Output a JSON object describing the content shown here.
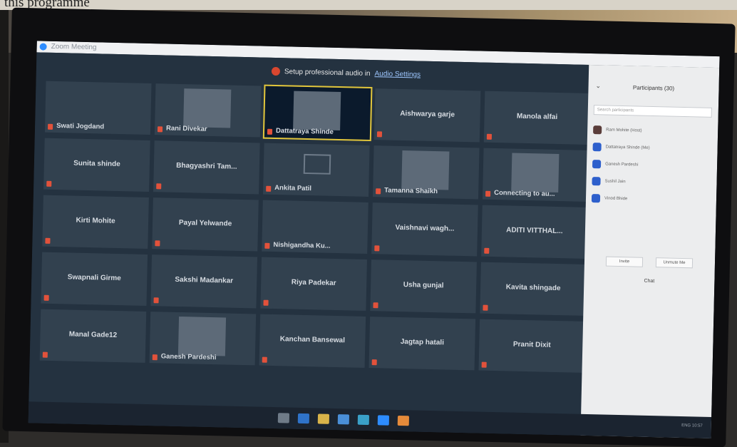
{
  "book_caption": "this programme",
  "window": {
    "title": "Zoom Meeting"
  },
  "banner": {
    "text": "Setup professional audio in",
    "link": "Audio Settings"
  },
  "participants": [
    {
      "name": "Swati Jogdand",
      "style": "label"
    },
    {
      "name": "Rani Divekar",
      "style": "label",
      "video": true
    },
    {
      "name": "Dattatraya Shinde",
      "style": "label",
      "video": true,
      "active": true
    },
    {
      "name": "Aishwarya garje",
      "style": "center"
    },
    {
      "name": "Manola alfai",
      "style": "center"
    },
    {
      "name": "Sunita shinde",
      "style": "center"
    },
    {
      "name": "Bhagyashri Tam...",
      "style": "center"
    },
    {
      "name": "Ankita Patil",
      "style": "label",
      "icon": "mail-icon"
    },
    {
      "name": "Tamanna Shaikh",
      "style": "label",
      "video": true
    },
    {
      "name": "Connecting to au...",
      "style": "label",
      "video": true
    },
    {
      "name": "Kirti Mohite",
      "style": "center"
    },
    {
      "name": "Payal Yelwande",
      "style": "center"
    },
    {
      "name": "Nishigandha Ku...",
      "style": "label"
    },
    {
      "name": "Vaishnavi wagh...",
      "style": "center"
    },
    {
      "name": "ADITI VITTHAL...",
      "style": "center"
    },
    {
      "name": "Swapnali Girme",
      "style": "center"
    },
    {
      "name": "Sakshi Madankar",
      "style": "center"
    },
    {
      "name": "Riya Padekar",
      "style": "center"
    },
    {
      "name": "Usha gunjal",
      "style": "center"
    },
    {
      "name": "Kavita shingade",
      "style": "center"
    },
    {
      "name": "Manal Gade12",
      "style": "center"
    },
    {
      "name": "Ganesh Pardeshi",
      "style": "label",
      "video": true
    },
    {
      "name": "Kanchan Bansewal",
      "style": "center"
    },
    {
      "name": "Jagtap hatali",
      "style": "center"
    },
    {
      "name": "Pranit Dixit",
      "style": "center"
    }
  ],
  "panel": {
    "title": "Participants (30)",
    "search_placeholder": "Search participants",
    "rows": [
      "Ram Mohite (Host)",
      "Dattatraya Shinde (Me)",
      "Ganesh Pardeshi",
      "Sushil Jain",
      "Vinod Bhide"
    ],
    "invite_label": "Invite",
    "unmute_label": "Unmute Me",
    "chat_label": "Chat"
  },
  "taskbar": {
    "tray": "ENG 10:57"
  }
}
